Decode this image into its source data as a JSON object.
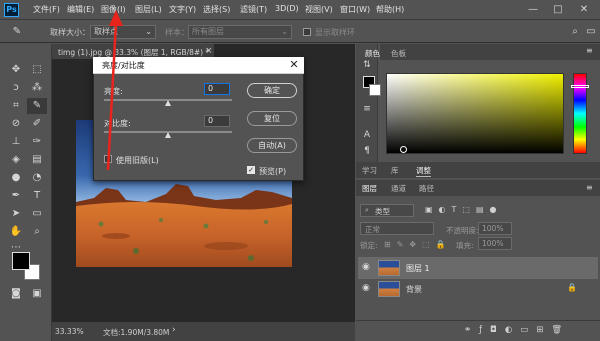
{
  "menubar": {
    "logo": "Ps",
    "items": [
      "文件(F)",
      "编辑(E)",
      "图像(I)",
      "图层(L)",
      "文字(Y)",
      "选择(S)",
      "滤镜(T)",
      "3D(D)",
      "视图(V)",
      "窗口(W)",
      "帮助(H)"
    ],
    "window_controls": [
      "—",
      "□",
      "✕"
    ]
  },
  "options": {
    "sample_size_label": "取样大小：",
    "sample_size_value": "取样点",
    "sample_label": "样本：",
    "sample_value": "所有图层",
    "show_ring_label": "显示取样环"
  },
  "document": {
    "tab_label": "timg (1).jpg @ 33.3% (图层 1, RGB/8#) *",
    "tab_close": "×",
    "zoom": "33.33%",
    "doc_info": "文档:1.90M/3.80M",
    "status_arrow": "›"
  },
  "dialog": {
    "title": "亮度/对比度",
    "close": "✕",
    "brightness_label": "亮度:",
    "brightness_value": "0",
    "contrast_label": "对比度:",
    "contrast_value": "0",
    "ok": "确定",
    "reset": "复位",
    "auto": "自动(A)",
    "legacy_label": "使用旧版(L)",
    "preview_label": "预览(P)",
    "legacy_checked": false,
    "preview_checked": true
  },
  "color_panel": {
    "tabs": [
      "颜色",
      "色板"
    ],
    "fg_color": "#000000",
    "bg_color": "#ffffff",
    "hue_color": "#f0f000"
  },
  "adjust_tabs": [
    "学习",
    "库",
    "调整"
  ],
  "layers": {
    "tabs": [
      "图层",
      "通道",
      "路径"
    ],
    "filter_kind": "类型",
    "blend_mode": "正常",
    "opacity_label": "不透明度:",
    "opacity_value": "100%",
    "lock_label": "锁定:",
    "fill_label": "填充:",
    "fill_value": "100%",
    "items": [
      {
        "name": "图层 1",
        "selected": true,
        "locked": false
      },
      {
        "name": "背景",
        "selected": false,
        "locked": true
      }
    ]
  },
  "icons": {
    "ps_logo": "photoshop-logo",
    "arrow": "red-pointer-arrow"
  },
  "colors": {
    "ui_bg": "#535353",
    "canvas_bg": "#282828",
    "accent": "#1473e6",
    "arrow": "#e8241c"
  }
}
